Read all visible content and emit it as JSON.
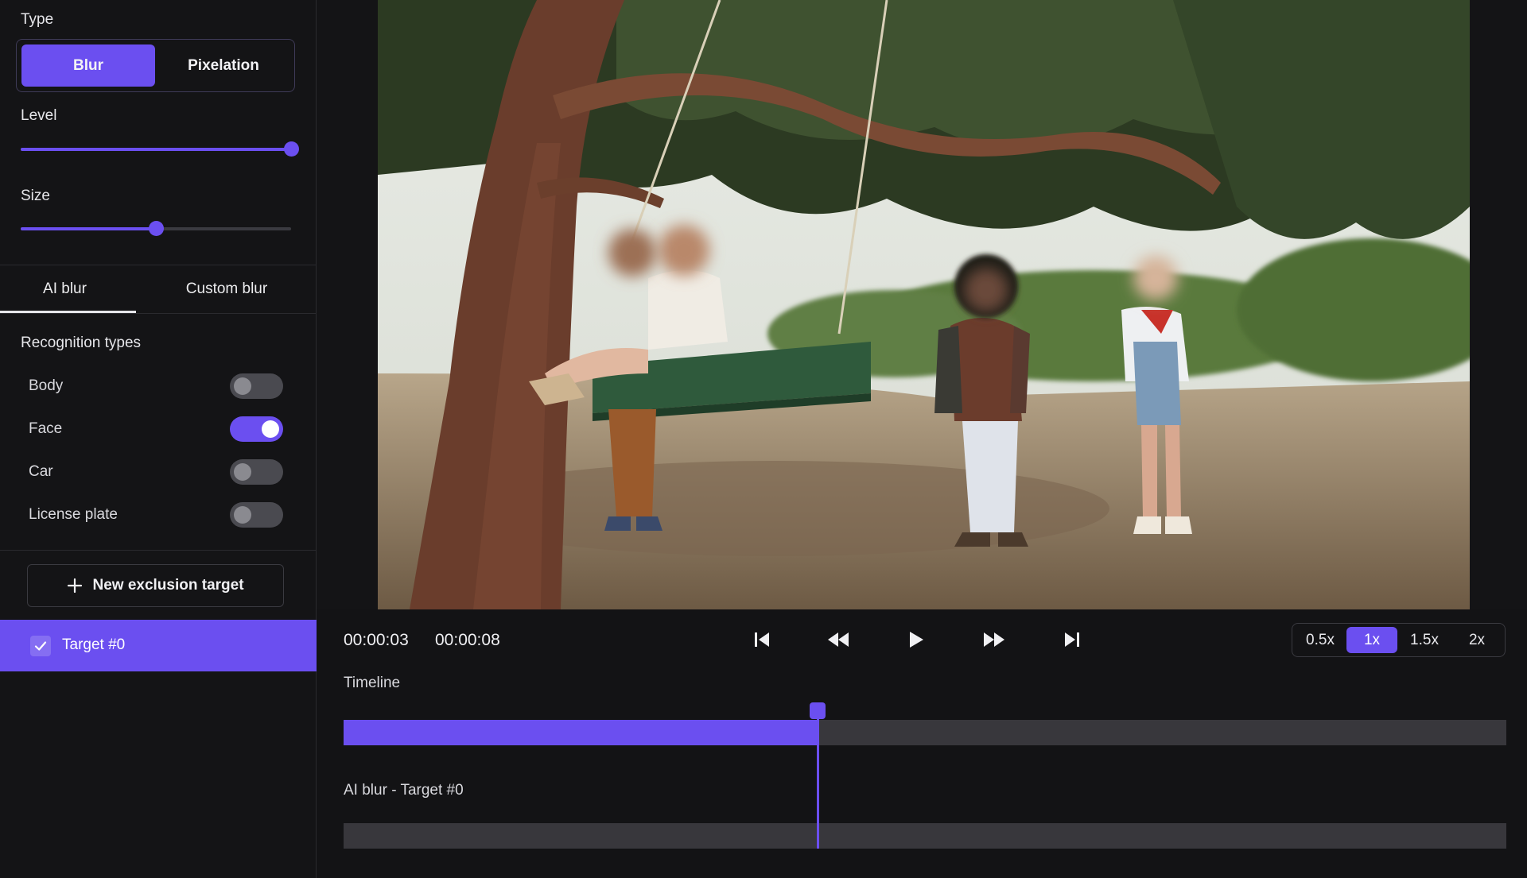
{
  "sidebar": {
    "type_label": "Type",
    "type_options": [
      "Blur",
      "Pixelation"
    ],
    "type_selected": "Blur",
    "level_label": "Level",
    "level_value": 1.0,
    "size_label": "Size",
    "size_value": 0.5,
    "tabs": [
      "AI blur",
      "Custom blur"
    ],
    "active_tab": "AI blur",
    "recognition_title": "Recognition types",
    "recognition": [
      {
        "label": "Body",
        "on": false
      },
      {
        "label": "Face",
        "on": true
      },
      {
        "label": "Car",
        "on": false
      },
      {
        "label": "License plate",
        "on": false
      }
    ],
    "new_exclusion_label": "New exclusion target",
    "target_label": "Target #0",
    "target_checked": true
  },
  "player": {
    "current_time": "00:00:03",
    "total_time": "00:00:08",
    "progress": 0.408,
    "speed_options": [
      "0.5x",
      "1x",
      "1.5x",
      "2x"
    ],
    "speed_selected": "1x",
    "timeline_label": "Timeline",
    "track_label": "AI blur - Target #0"
  },
  "colors": {
    "accent": "#6b4ff0",
    "background": "#131315",
    "track": "#38373c"
  },
  "icons": {
    "prev": "skip-to-start-icon",
    "rewind": "rewind-icon",
    "play": "play-icon",
    "forward": "fast-forward-icon",
    "next": "skip-to-end-icon",
    "add": "plus-icon",
    "check": "check-icon"
  }
}
